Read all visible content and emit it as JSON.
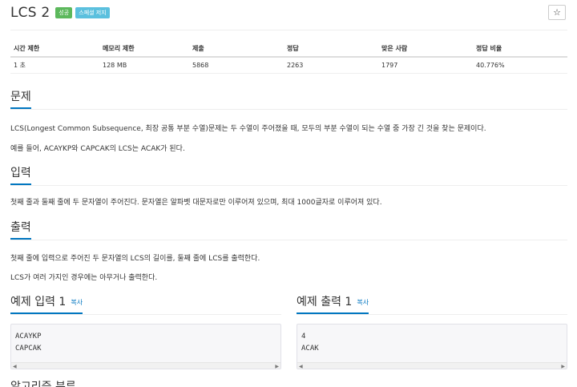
{
  "problem": {
    "title": "LCS 2",
    "badges": [
      "성공",
      "스페셜 저지"
    ],
    "star_icon": "star-icon"
  },
  "info_table": {
    "headers": [
      "시간 제한",
      "메모리 제한",
      "제출",
      "정답",
      "맞은 사람",
      "정답 비율"
    ],
    "values": [
      "1 초",
      "128 MB",
      "5868",
      "2263",
      "1797",
      "40.776%"
    ]
  },
  "sections": {
    "problem": {
      "heading": "문제",
      "paragraphs": [
        "LCS(Longest Common Subsequence, 최장 공통 부분 수열)문제는 두 수열이 주어졌을 때, 모두의 부분 수열이 되는 수열 중 가장 긴 것을 찾는 문제이다.",
        "예를 들어, ACAYKP와 CAPCAK의 LCS는 ACAK가 된다."
      ]
    },
    "input": {
      "heading": "입력",
      "paragraphs": [
        "첫째 줄과 둘째 줄에 두 문자열이 주어진다. 문자열은 알파벳 대문자로만 이루어져 있으며, 최대 1000글자로 이루어져 있다."
      ]
    },
    "output": {
      "heading": "출력",
      "paragraphs": [
        "첫째 줄에 입력으로 주어진 두 문자열의 LCS의 길이를, 둘째 줄에 LCS를 출력한다.",
        "LCS가 여러 가지인 경우에는 아무거나 출력한다."
      ]
    }
  },
  "examples": {
    "input": {
      "heading": "예제 입력 1",
      "copy_label": "복사",
      "lines": [
        "ACAYKP",
        "CAPCAK"
      ]
    },
    "output": {
      "heading": "예제 출력 1",
      "copy_label": "복사",
      "lines": [
        "4",
        "ACAK"
      ]
    }
  },
  "next_section_heading": "알고리즘 분류",
  "colors": {
    "accent": "#0076c0",
    "success_badge": "#5cb85c",
    "info_badge": "#5bc0de"
  }
}
